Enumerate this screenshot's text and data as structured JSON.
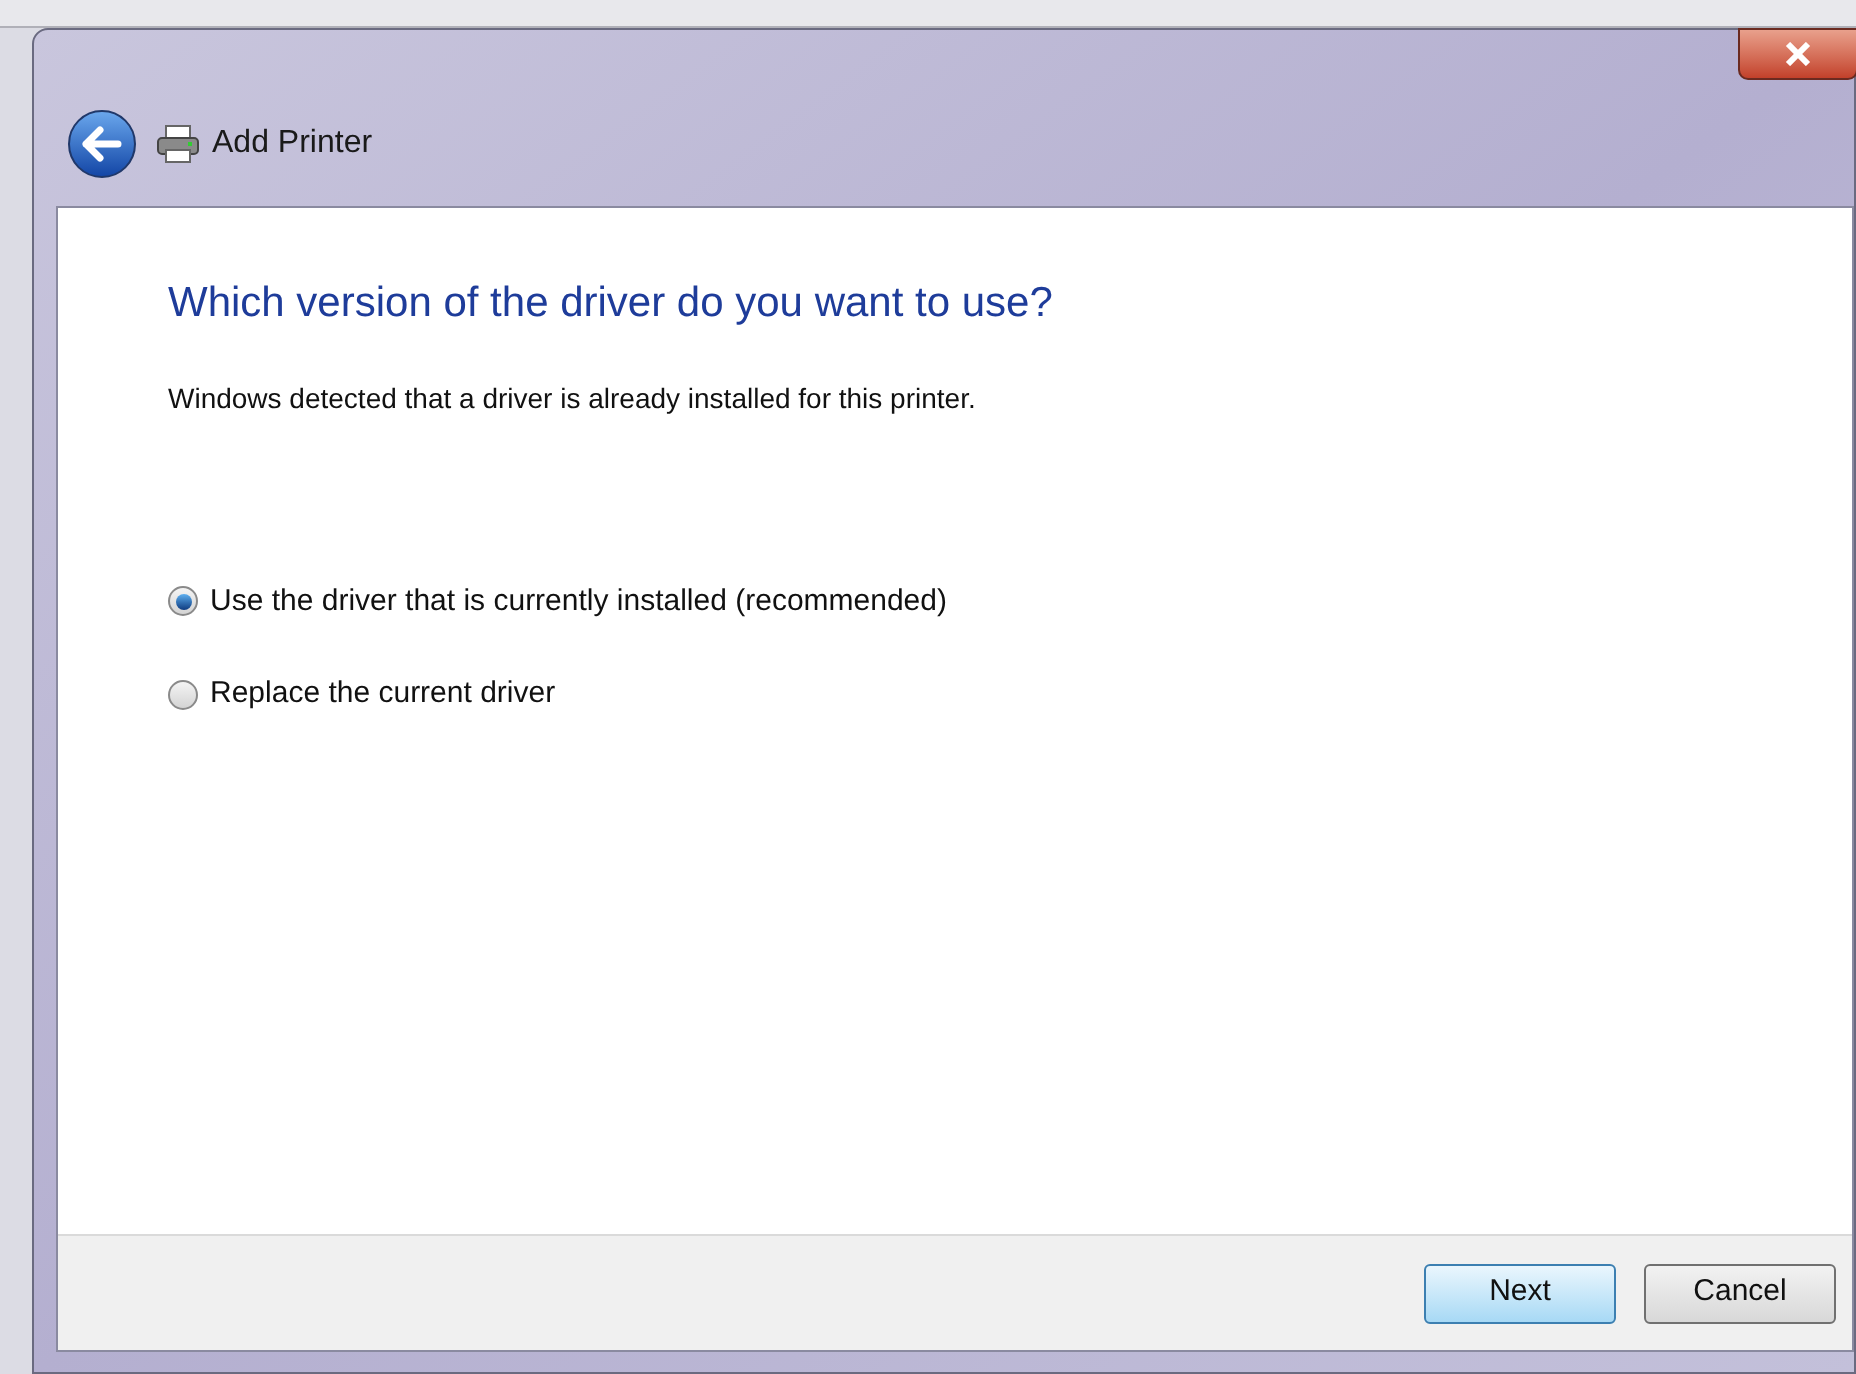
{
  "window": {
    "title": "Add Printer"
  },
  "heading": "Which version of the driver do you want to use?",
  "description": "Windows detected that a driver is already installed for this printer.",
  "options": [
    {
      "label": "Use the driver that is currently installed (recommended)",
      "selected": true
    },
    {
      "label": "Replace the current driver",
      "selected": false
    }
  ],
  "buttons": [
    {
      "label": "Next",
      "kind": "default"
    },
    {
      "label": "Cancel",
      "kind": "normal"
    }
  ]
}
